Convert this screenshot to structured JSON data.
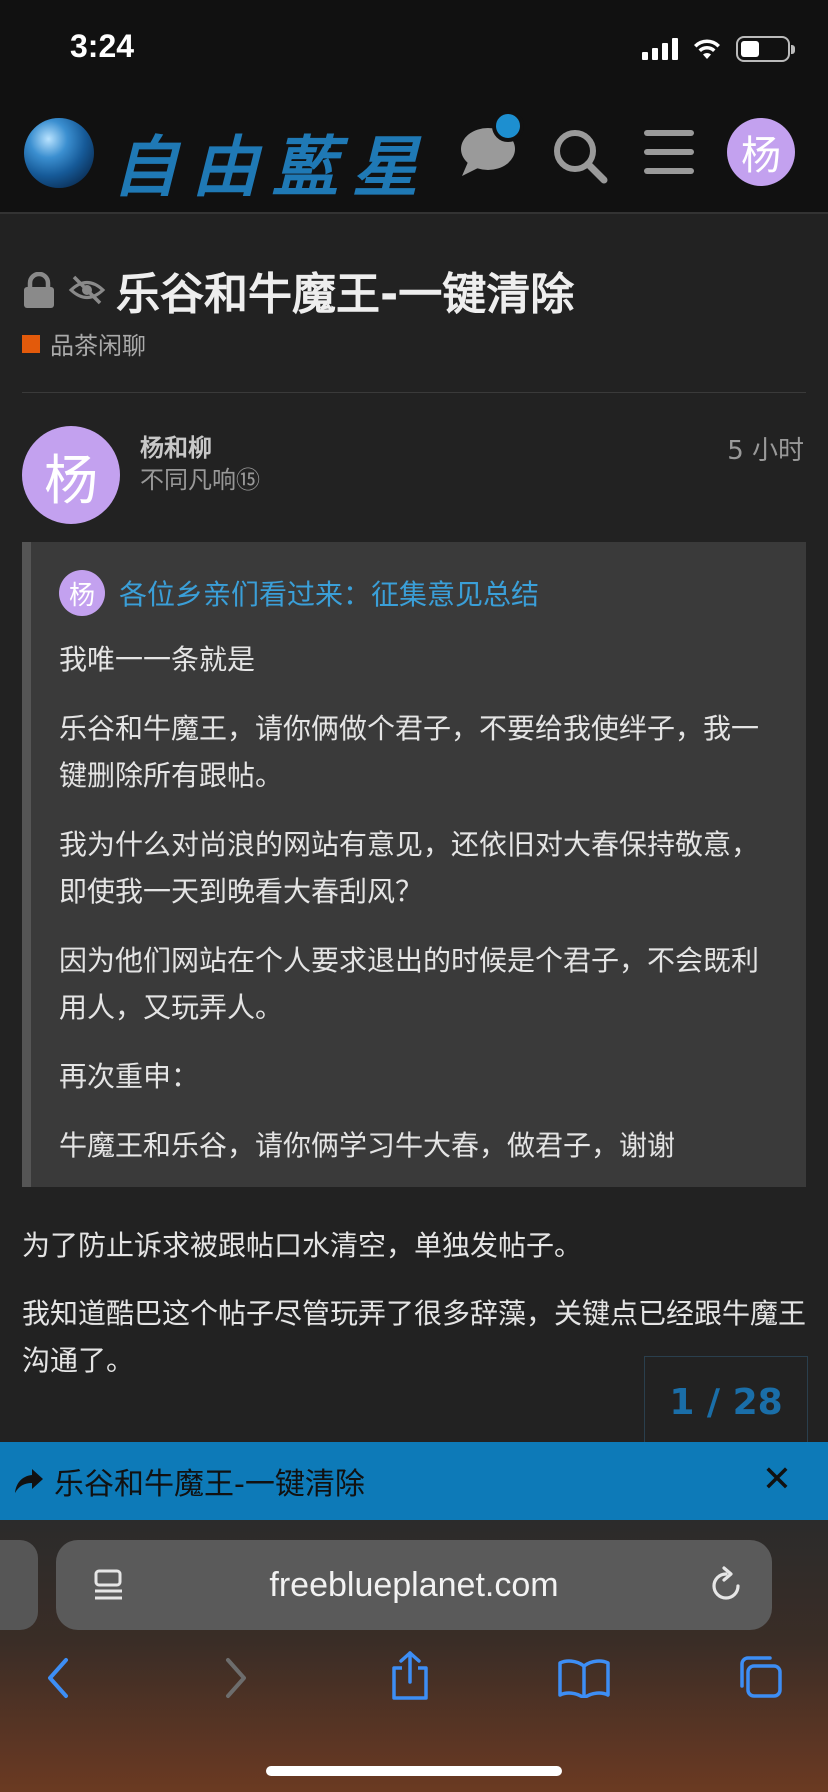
{
  "status_bar": {
    "time": "3:24"
  },
  "site": {
    "logo_text": "自由藍星",
    "user_initial": "杨"
  },
  "topic": {
    "title": "乐谷和牛魔王-一键清除",
    "category": "品茶闲聊",
    "category_color": "#e35a0b"
  },
  "post": {
    "author_initial": "杨",
    "username": "杨和柳",
    "user_title": "不同凡响⑮",
    "time": "5 小时",
    "quote": {
      "avatar_initial": "杨",
      "source_title": "各位乡亲们看过来：征集意见总结",
      "paragraphs": [
        "我唯一一条就是",
        "乐谷和牛魔王，请你俩做个君子，不要给我使绊子，我一键删除所有跟帖。",
        "我为什么对尚浪的网站有意见，还依旧对大春保持敬意，即使我一天到晚看大春刮风？",
        "因为他们网站在个人要求退出的时候是个君子，不会既利用人，又玩弄人。",
        "再次重申：",
        "牛魔王和乐谷，请你俩学习牛大春，做君子，谢谢"
      ]
    },
    "body": [
      "为了防止诉求被跟帖口水清空，单独发帖子。",
      "我知道酷巴这个帖子尽管玩弄了很多辞藻，关键点已经跟牛魔王沟通了。",
      "……"
    ]
  },
  "progress": {
    "label": "1 / 28",
    "current": 1,
    "total": 28
  },
  "share_banner": {
    "title": "乐谷和牛魔王-一键清除",
    "close": "✕"
  },
  "browser": {
    "url": "freeblueplanet.com"
  },
  "colors": {
    "accent": "#0d7ab8",
    "link": "#3a9fd8",
    "avatar": "#c3a1ef"
  }
}
